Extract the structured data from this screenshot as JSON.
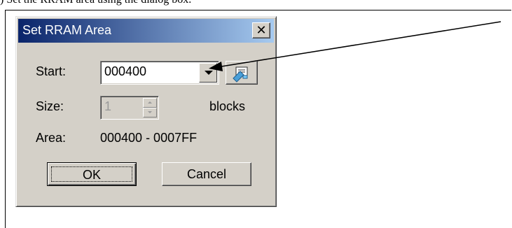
{
  "document": {
    "top_text": ") Set the RRAM area using the dialog box."
  },
  "dialog": {
    "title": "Set RRAM Area",
    "close_glyph": "✕",
    "start_label": "Start:",
    "start_value": "000400",
    "size_label": "Size:",
    "size_value": "1",
    "size_unit": "blocks",
    "area_label": "Area:",
    "area_value": "000400 - 0007FF",
    "ok_label": "OK",
    "cancel_label": "Cancel"
  },
  "colors": {
    "dialog_face": "#d4d0c8",
    "title_gradient_start": "#0a246a",
    "title_gradient_end": "#a6caf0"
  },
  "icons": {
    "browse": "address-book-icon",
    "dropdown": "chevron-down-icon",
    "close": "close-icon"
  }
}
